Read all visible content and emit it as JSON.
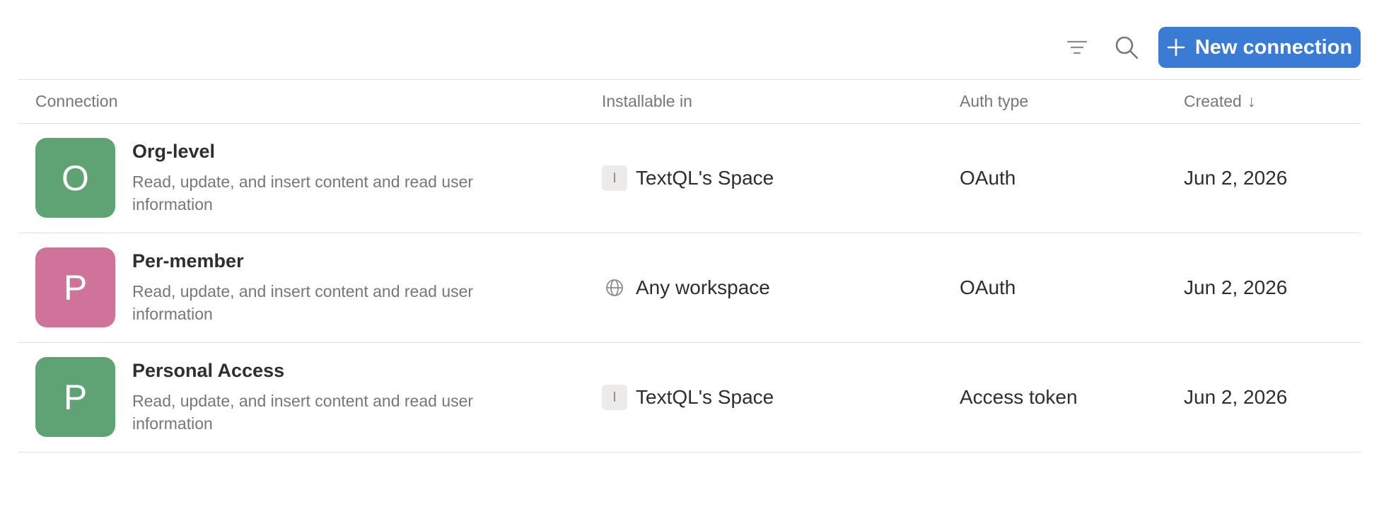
{
  "toolbar": {
    "filter_icon": "filter-icon",
    "search_icon": "search-icon",
    "new_button_label": "New connection",
    "accent_color": "#3a7bd5"
  },
  "table": {
    "headers": {
      "connection": "Connection",
      "installable_in": "Installable in",
      "auth_type": "Auth type",
      "created": "Created",
      "created_sort_arrow": "↓"
    },
    "rows": [
      {
        "avatar_letter": "O",
        "avatar_color": "#5fa374",
        "name": "Org-level",
        "description": "Read, update, and insert content and read user information",
        "installable_icon_letter": "I",
        "installable_in": "TextQL's Space",
        "auth_type": "OAuth",
        "created": "Jun 2, 2026"
      },
      {
        "avatar_color": "#d0739a",
        "avatar_letter": "P",
        "name": "Per-member",
        "description": "Read, update, and insert content and read user information",
        "installable_icon": "globe-icon",
        "installable_in": "Any workspace",
        "auth_type": "OAuth",
        "created": "Jun 2, 2026"
      },
      {
        "avatar_letter": "P",
        "avatar_color": "#5fa374",
        "name": "Personal Access",
        "description": "Read, update, and insert content and read user information",
        "installable_icon_letter": "I",
        "installable_in": "TextQL's Space",
        "auth_type": "Access token",
        "created": "Jun 2, 2026"
      }
    ]
  }
}
